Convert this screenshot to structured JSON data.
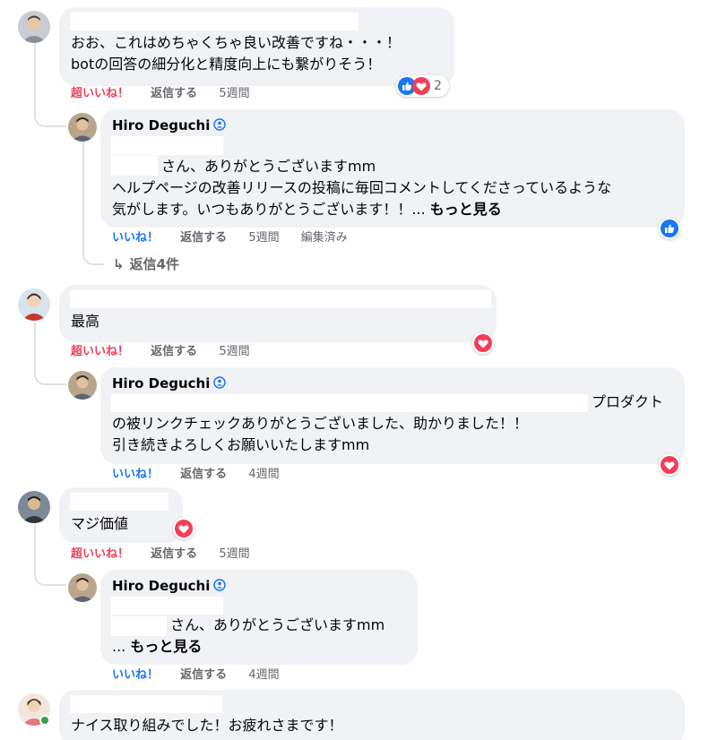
{
  "comments": [
    {
      "text_lines": [
        "おお、これはめちゃくちゃ良い改善ですね・・・！",
        "botの回答の細分化と精度向上にも繋がりそう！"
      ],
      "actions": {
        "reaction": "超いいね！",
        "reply": "返信する",
        "time": "5週間"
      },
      "reactions": {
        "icons": [
          "like-reaction",
          "love-reaction"
        ],
        "count": "2"
      },
      "reply": {
        "author": "Hiro Deguchi",
        "text_lines": [
          "さん、ありがとうございますmm",
          "ヘルプページの改善リリースの投稿に毎回コメントしてくださっているような",
          "気がします。いつもありがとうございます！！..."
        ],
        "more": "もっと見る",
        "actions": {
          "reaction": "いいね！",
          "reply": "返信する",
          "time": "5週間",
          "edited": "編集済み"
        },
        "reaction_icon": "like-reaction"
      },
      "more_replies": "返信4件"
    },
    {
      "text_lines": [
        "最高"
      ],
      "actions": {
        "reaction": "超いいね！",
        "reply": "返信する",
        "time": "5週間"
      },
      "reaction_icon": "love-reaction",
      "reply": {
        "author": "Hiro Deguchi",
        "text_lines": [
          "プロダクト",
          "の被リンクチェックありがとうございました、助かりました！！",
          "引き続きよろしくお願いいたしますmm"
        ],
        "actions": {
          "reaction": "いいね！",
          "reply": "返信する",
          "time": "4週間"
        },
        "reaction_icon": "love-reaction"
      }
    },
    {
      "text_lines": [
        "マジ価値"
      ],
      "actions": {
        "reaction": "超いいね！",
        "reply": "返信する",
        "time": "5週間"
      },
      "reaction_icon": "love-reaction",
      "reply": {
        "author": "Hiro Deguchi",
        "text_lines": [
          "さん、ありがとうございますmm",
          "..."
        ],
        "more": "もっと見る",
        "actions": {
          "reaction": "いいね！",
          "reply": "返信する",
          "time": "4週間"
        }
      }
    },
    {
      "text_lines": [
        "ナイス取り組みでした！お疲れさまです！"
      ]
    }
  ],
  "colors": {
    "bubble": "#f0f2f5",
    "super_like": "#f33e58",
    "like": "#1877f2",
    "muted": "#65676b",
    "thread_line": "#dfe1e5"
  }
}
